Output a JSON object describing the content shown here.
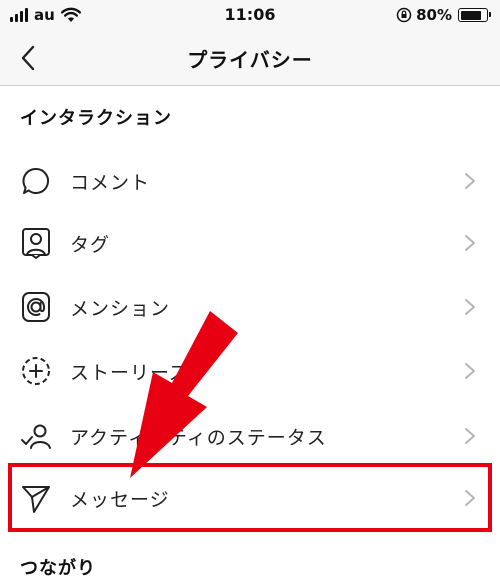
{
  "status_bar": {
    "carrier": "au",
    "time": "11:06",
    "battery": "80%",
    "battery_level": 0.8
  },
  "nav": {
    "title": "プライバシー",
    "back_icon": "chevron-left-icon"
  },
  "sections": [
    {
      "title": "インタラクション",
      "items": [
        {
          "label": "コメント",
          "icon": "comment-bubble-icon"
        },
        {
          "label": "タグ",
          "icon": "tag-person-icon"
        },
        {
          "label": "メンション",
          "icon": "at-sign-icon"
        },
        {
          "label": "ストーリーズ",
          "icon": "story-add-icon"
        },
        {
          "label": "アクティビティのステータス",
          "icon": "activity-status-icon"
        },
        {
          "label": "メッセージ",
          "icon": "paper-plane-icon",
          "highlighted": true
        }
      ]
    },
    {
      "title": "つながり",
      "items": []
    }
  ],
  "colors": {
    "annotation_red": "#e60012",
    "chevron": "#b5b5b5"
  }
}
